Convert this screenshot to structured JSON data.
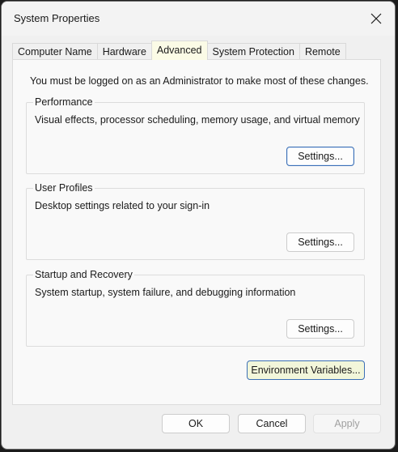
{
  "window": {
    "title": "System Properties",
    "close_icon": "close-icon"
  },
  "tabs": [
    {
      "label": "Computer Name",
      "active": false
    },
    {
      "label": "Hardware",
      "active": false
    },
    {
      "label": "Advanced",
      "active": true
    },
    {
      "label": "System Protection",
      "active": false
    },
    {
      "label": "Remote",
      "active": false
    }
  ],
  "notice": "You must be logged on as an Administrator to make most of these changes.",
  "groups": {
    "performance": {
      "legend": "Performance",
      "description": "Visual effects, processor scheduling, memory usage, and virtual memory",
      "button": "Settings..."
    },
    "user_profiles": {
      "legend": "User Profiles",
      "description": "Desktop settings related to your sign-in",
      "button": "Settings..."
    },
    "startup_recovery": {
      "legend": "Startup and Recovery",
      "description": "System startup, system failure, and debugging information",
      "button": "Settings..."
    }
  },
  "env_button": "Environment Variables...",
  "dialog_buttons": {
    "ok": "OK",
    "cancel": "Cancel",
    "apply": "Apply"
  }
}
